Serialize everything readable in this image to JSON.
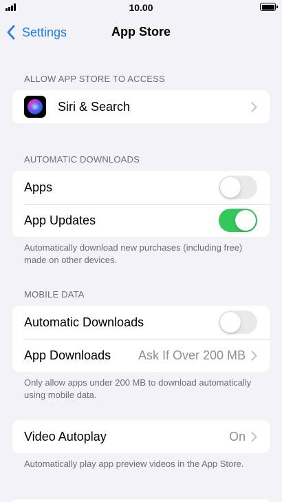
{
  "status_bar": {
    "time": "10.00"
  },
  "nav": {
    "back_label": "Settings",
    "title": "App Store"
  },
  "sections": {
    "access": {
      "header": "ALLOW APP STORE TO ACCESS",
      "siri_label": "Siri & Search"
    },
    "auto_downloads": {
      "header": "AUTOMATIC DOWNLOADS",
      "apps_label": "Apps",
      "apps_on": false,
      "updates_label": "App Updates",
      "updates_on": true,
      "footer": "Automatically download new purchases (including free) made on other devices."
    },
    "mobile_data": {
      "header": "MOBILE DATA",
      "auto_label": "Automatic Downloads",
      "auto_on": false,
      "app_downloads_label": "App Downloads",
      "app_downloads_value": "Ask If Over 200 MB",
      "footer": "Only allow apps under 200 MB to download automatically using mobile data."
    },
    "video": {
      "autoplay_label": "Video Autoplay",
      "autoplay_value": "On",
      "footer": "Automatically play app preview videos in the App Store."
    }
  },
  "colors": {
    "accent": "#1d7cf2",
    "toggle_on": "#34c759",
    "toggle_off": "#e9e9ea",
    "background": "#f2f2f7",
    "secondary_text": "#6d6d72"
  },
  "icons": [
    "cellular-signal-icon",
    "battery-icon",
    "chevron-left-icon",
    "siri-icon",
    "chevron-right-icon"
  ]
}
